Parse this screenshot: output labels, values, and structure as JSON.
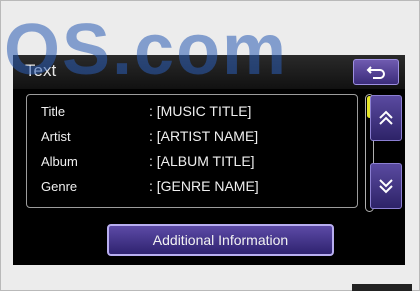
{
  "watermark": {
    "text": "OS.com"
  },
  "screen": {
    "title": "Text",
    "back_icon": "return-arrow-icon",
    "rows": [
      {
        "label": "Title",
        "value": ": [MUSIC TITLE]"
      },
      {
        "label": "Artist",
        "value": ": [ARTIST NAME]"
      },
      {
        "label": "Album",
        "value": ": [ALBUM TITLE]"
      },
      {
        "label": "Genre",
        "value": ": [GENRE NAME]"
      }
    ],
    "scroll_up_icon": "double-chevron-up-icon",
    "scroll_down_icon": "double-chevron-down-icon",
    "additional_button_label": "Additional Information"
  },
  "colors": {
    "button_purple": "#3b2c7a",
    "scroll_thumb": "#e6e62a",
    "watermark_blue": "#2c5cb4"
  }
}
